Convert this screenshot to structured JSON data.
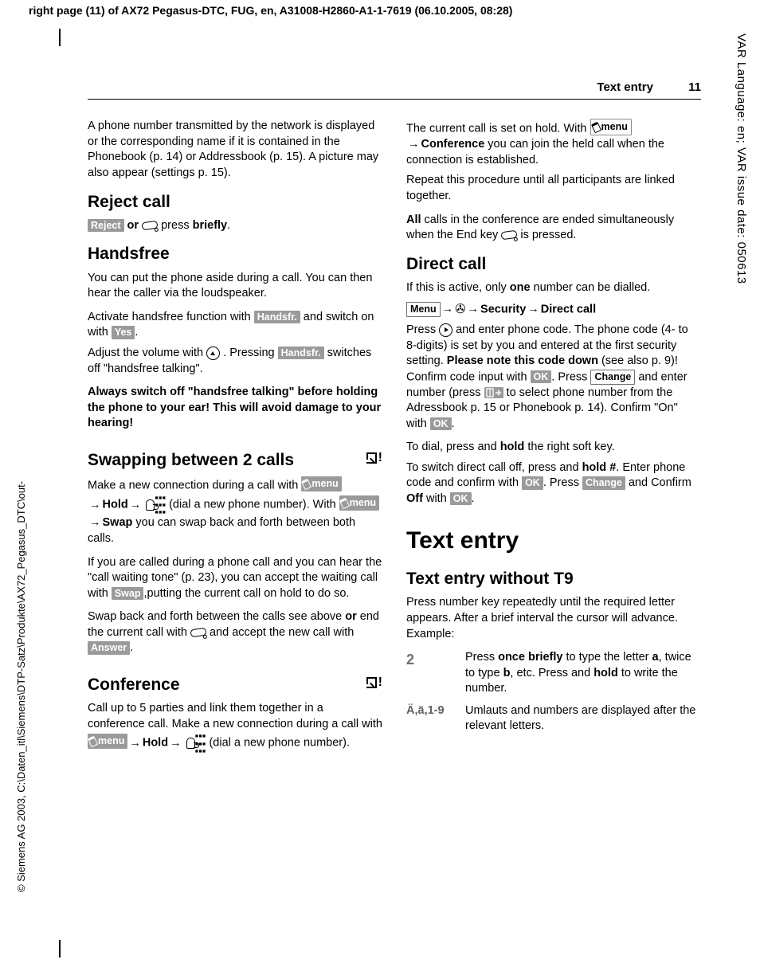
{
  "meta": {
    "top_header": "right page (11) of AX72 Pegasus-DTC, FUG, en, A31008-H2860-A1-1-7619 (06.10.2005, 08:28)",
    "side_left": "© Siemens AG 2003, C:\\Daten_itl\\Siemens\\DTP-Satz\\Produkte\\AX72_Pegasus_DTC\\out-",
    "side_right": "VAR Language: en; VAR issue date: 050613"
  },
  "page": {
    "running_head": "Text entry",
    "page_number": "11"
  },
  "left": {
    "intro": "A phone number transmitted by the network is displayed or the corresponding name if it is contained in the Phonebook (p. 14) or Addressbook (p. 15). A picture may also appear (settings p. 15).",
    "reject": {
      "h": "Reject call",
      "k_reject": "Reject",
      "txt_or": " or ",
      "txt_press": " press ",
      "txt_briefly": "briefly",
      "dot": "."
    },
    "hands": {
      "h": "Handsfree",
      "p1": "You can put the phone aside during a call. You can then hear the caller via the loudspeaker.",
      "p2a": "Activate handsfree function with ",
      "k_handsfr": "Handsfr.",
      "p2b": " and switch on with ",
      "k_yes": "Yes",
      "p2c": ".",
      "p3a": "Adjust the volume with ",
      "p3b": " . Pressing ",
      "p3c": " switches off \"handsfree talking\".",
      "warn": "Always switch off \"handsfree talking\" before holding the phone to your ear! This will avoid damage to your hearing!"
    },
    "swap": {
      "h": "Swapping between 2 calls",
      "p1a": "Make a new connection during a call with ",
      "k_menu": "menu",
      "lbl_hold": "Hold",
      "p1b": " (dial a new phone number). With ",
      "lbl_swap": "Swap",
      "p1c": " you can swap back and forth between both calls.",
      "p2a": "If you are called during a phone call and you can hear the \"call waiting tone\" (p. 23), you can accept the waiting call with ",
      "k_swap": "Swap",
      "p2b": ",putting the current call on hold to do so.",
      "p3a": "Swap back and forth between the calls see above ",
      "p3or": "or",
      "p3b": " end the current call with ",
      "p3c": " and accept the new call with ",
      "k_answer": "Answer",
      "p3d": "."
    },
    "conf": {
      "h": "Conference",
      "p1a": "Call up to 5 parties and link them together in a conference call. Make a new connection during a call with ",
      "lbl_hold": "Hold",
      "p1b": " (dial a new phone number)."
    }
  },
  "right": {
    "conf2": {
      "p1a": "The current call is set on hold. With ",
      "k_menu": "menu",
      "lbl_conf": "Conference",
      "p1b": " you can join the held call when the connection is established.",
      "p2": "Repeat this procedure until all participants are linked together.",
      "p3a": "All",
      "p3b": " calls in the conference are ended simultaneously when the End key ",
      "p3c": " is pressed."
    },
    "direct": {
      "h": "Direct call",
      "p1a": "If this is active, only ",
      "p1one": "one",
      "p1b": " number can be dialled.",
      "k_menu": "Menu",
      "lbl_sec": "Security",
      "lbl_dc": "Direct call",
      "p2a": "Press ",
      "p2b": " and enter phone code. The phone code (4- to 8-digits) is set by you and entered at the first security setting. ",
      "p2note": "Please note this code down",
      "p2c": " (see also p. 9)! Confirm code input with ",
      "k_ok": "OK",
      "p2d": ". Press ",
      "k_change": "Change",
      "p2e": " and enter number (press ",
      "p2f": " to select phone number from the Adressbook p. 15 or Phonebook p. 14). Confirm \"On\" with ",
      "p2g": ".",
      "p3a": "To dial, press and ",
      "p3hold": "hold",
      "p3b": " the right soft key.",
      "p4a": "To switch direct call off, press and ",
      "p4hold": "hold",
      "p4hash": " #",
      "p4b": ". Enter phone code and confirm with ",
      "p4c": ". Press ",
      "p4d": " and Confirm ",
      "p4off": "Off",
      "p4e": " with ",
      "p4f": "."
    },
    "textentry": {
      "h1": "Text entry",
      "h2": "Text entry without T9",
      "p1": "Press number key repeatedly until the required letter appears. After a brief interval the cursor will advance. Example:",
      "row1_k": "2",
      "row1_a": "Press ",
      "row1_ob": "once briefly",
      "row1_b": " to type the letter ",
      "row1_la": "a",
      "row1_c": ", twice to type ",
      "row1_lb": "b",
      "row1_d": ", etc. Press and ",
      "row1_hold": "hold",
      "row1_e": " to write the number.",
      "row2_k": "Ä,ä,1-9",
      "row2": "Umlauts and numbers are displayed after the relevant letters."
    }
  }
}
